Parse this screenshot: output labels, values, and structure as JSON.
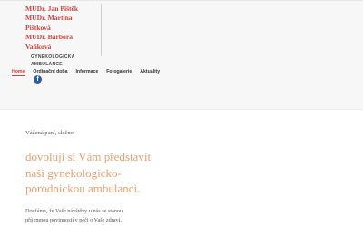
{
  "brand": {
    "names": [
      "MUDr. Jan Pištěk",
      "MUDr. Martina",
      "Pištková",
      "MUDr. Barbora",
      "Vaňková"
    ],
    "subtitle": [
      "GYNEKOLOGICKÁ",
      "AMBULANCE"
    ],
    "color": "#d2413c"
  },
  "nav": {
    "items": [
      {
        "label": "Home",
        "active": true
      },
      {
        "label": "Ordinační doba",
        "active": false
      },
      {
        "label": "Informace",
        "active": false
      },
      {
        "label": "Fotogalerie",
        "active": false
      },
      {
        "label": "Aktuality",
        "active": false
      }
    ]
  },
  "social": {
    "icon": "facebook-icon",
    "glyph": "f",
    "color": "#2f5aa8"
  },
  "content": {
    "greeting": "Vážená paní, slečno,",
    "headline": [
      "dovoluji si Vám představit",
      "naši gynekologicko-",
      "porodnickou ambulanci."
    ],
    "headline_color": "#e8a06f",
    "paragraph": [
      "Doufáme, že Vaše návštěvy u nás se stanou",
      "příjemnou povinností v péči o Vaše zdraví."
    ]
  }
}
